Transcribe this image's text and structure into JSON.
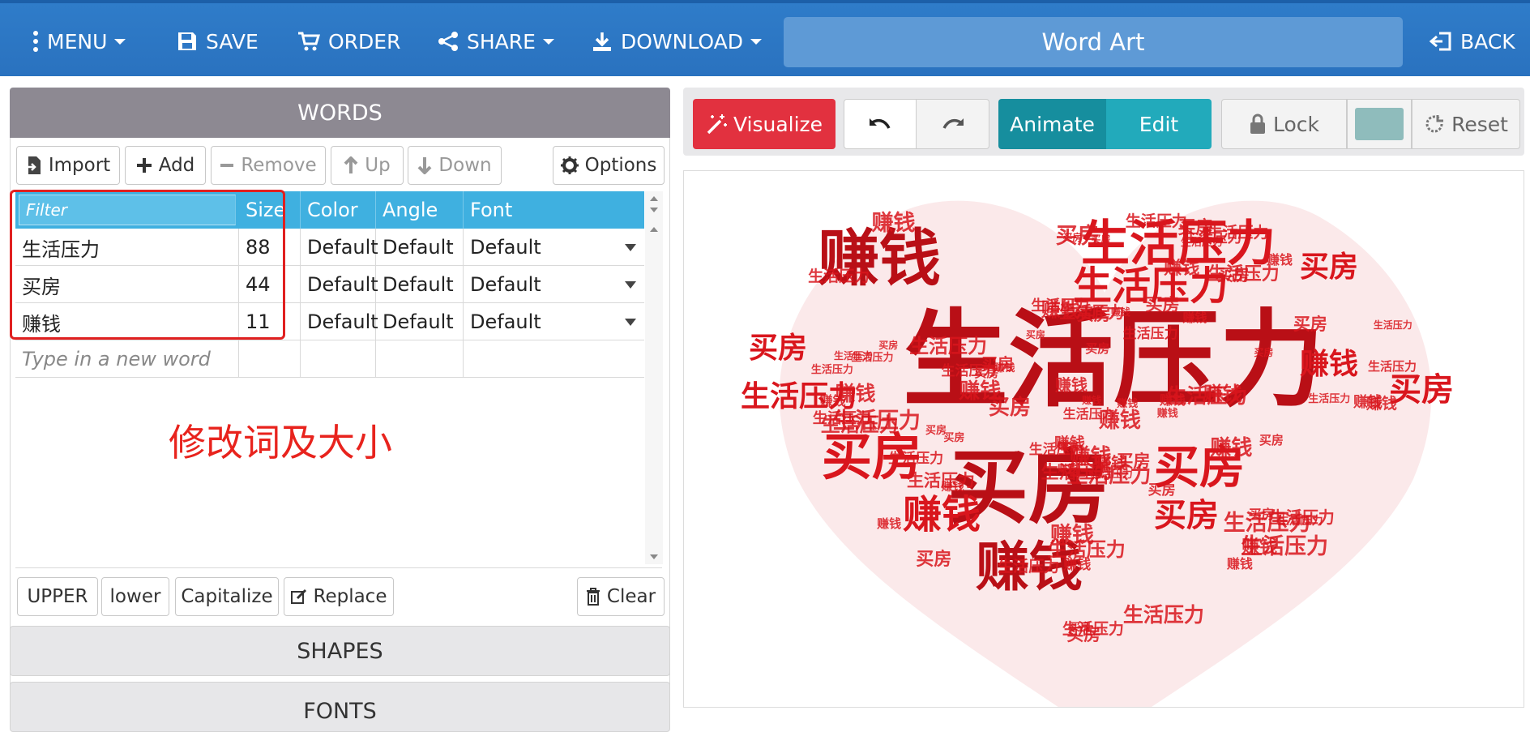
{
  "nav": {
    "menu": "MENU",
    "save": "SAVE",
    "order": "ORDER",
    "share": "SHARE",
    "download": "DOWNLOAD",
    "title": "Word Art",
    "back": "BACK"
  },
  "words_panel": {
    "header": "WORDS",
    "toolbar": {
      "import": "Import",
      "add": "Add",
      "remove": "Remove",
      "up": "Up",
      "down": "Down",
      "options": "Options"
    },
    "columns": {
      "filter_placeholder": "Filter",
      "size": "Size",
      "color": "Color",
      "angle": "Angle",
      "font": "Font"
    },
    "rows": [
      {
        "word": "生活压力",
        "size": "88",
        "color": "Default",
        "angle": "Default",
        "font": "Default"
      },
      {
        "word": "买房",
        "size": "44",
        "color": "Default",
        "angle": "Default",
        "font": "Default"
      },
      {
        "word": "赚钱",
        "size": "11",
        "color": "Default",
        "angle": "Default",
        "font": "Default"
      }
    ],
    "new_word_placeholder": "Type in a new word",
    "annotation": "修改词及大小",
    "bottom_toolbar": {
      "upper": "UPPER",
      "lower": "lower",
      "capitalize": "Capitalize",
      "replace": "Replace",
      "clear": "Clear"
    }
  },
  "sections": {
    "shapes": "SHAPES",
    "fonts": "FONTS"
  },
  "right_toolbar": {
    "visualize": "Visualize",
    "animate": "Animate",
    "edit": "Edit",
    "lock": "Lock",
    "reset": "Reset",
    "color_swatch": "#8fbcbc"
  },
  "wordcloud": {
    "shape": "heart",
    "color": "#d9161d",
    "words": [
      "生活压力",
      "买房",
      "赚钱"
    ]
  }
}
